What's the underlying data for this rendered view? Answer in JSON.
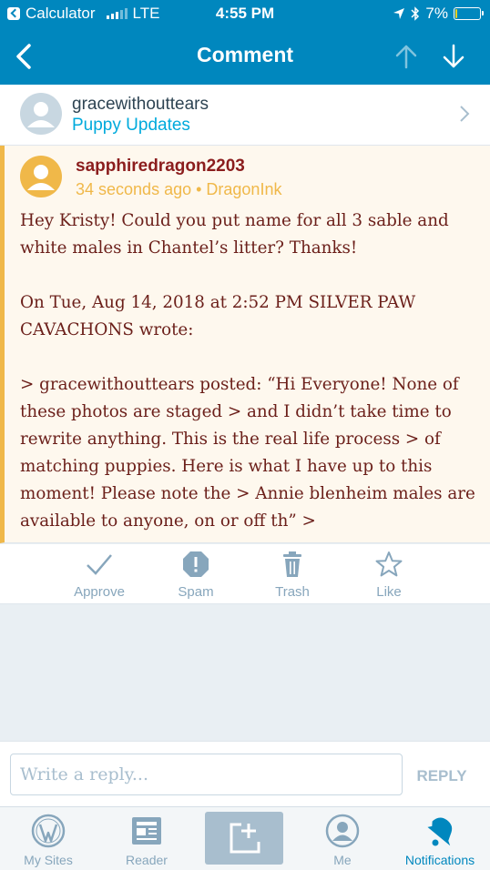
{
  "status_bar": {
    "back_app": "Calculator",
    "carrier": "LTE",
    "time": "4:55 PM",
    "battery": "7%",
    "battery_level": 0.07,
    "icons": [
      "signal-icon",
      "location-arrow-icon",
      "bluetooth-icon",
      "battery-icon"
    ]
  },
  "nav": {
    "title": "Comment",
    "icons": [
      "back-chevron-icon",
      "up-arrow-icon",
      "down-arrow-icon"
    ]
  },
  "post": {
    "author": "gracewithouttears",
    "site": "Puppy Updates",
    "icons": [
      "avatar-placeholder-icon",
      "chevron-right-icon"
    ]
  },
  "comment": {
    "author": "sapphiredragon2203",
    "meta": "34 seconds ago • DragonInk",
    "paragraphs": [
      "Hey Kristy! Could you put name for all 3 sable and white males in Chantel’s litter? Thanks!",
      "On Tue, Aug 14, 2018 at 2:52 PM SILVER PAW CAVACHONS  wrote:",
      "> gracewithouttears posted: “Hi Everyone! None of these photos are staged > and I didn’t take time to rewrite anything. This is the real life process > of matching puppies. Here is what I have up to this moment! Please note the > Annie blenheim males are available to anyone, on or off th” >"
    ],
    "accent_color": "#f0b849"
  },
  "actions": [
    {
      "label": "Approve",
      "icon": "checkmark-icon"
    },
    {
      "label": "Spam",
      "icon": "spam-icon"
    },
    {
      "label": "Trash",
      "icon": "trash-icon"
    },
    {
      "label": "Like",
      "icon": "star-icon"
    }
  ],
  "reply": {
    "placeholder": "Write a reply...",
    "button": "REPLY"
  },
  "tabbar": {
    "tabs": [
      {
        "label": "My Sites",
        "icon": "wordpress-icon"
      },
      {
        "label": "Reader",
        "icon": "reader-icon"
      },
      {
        "label": "",
        "icon": "new-post-icon"
      },
      {
        "label": "Me",
        "icon": "me-icon"
      },
      {
        "label": "Notifications",
        "icon": "notifications-bell-icon"
      }
    ],
    "active": "Notifications"
  },
  "colors": {
    "brand_blue": "#0087be",
    "link_blue": "#00aadc",
    "muted": "#87a6bc"
  }
}
